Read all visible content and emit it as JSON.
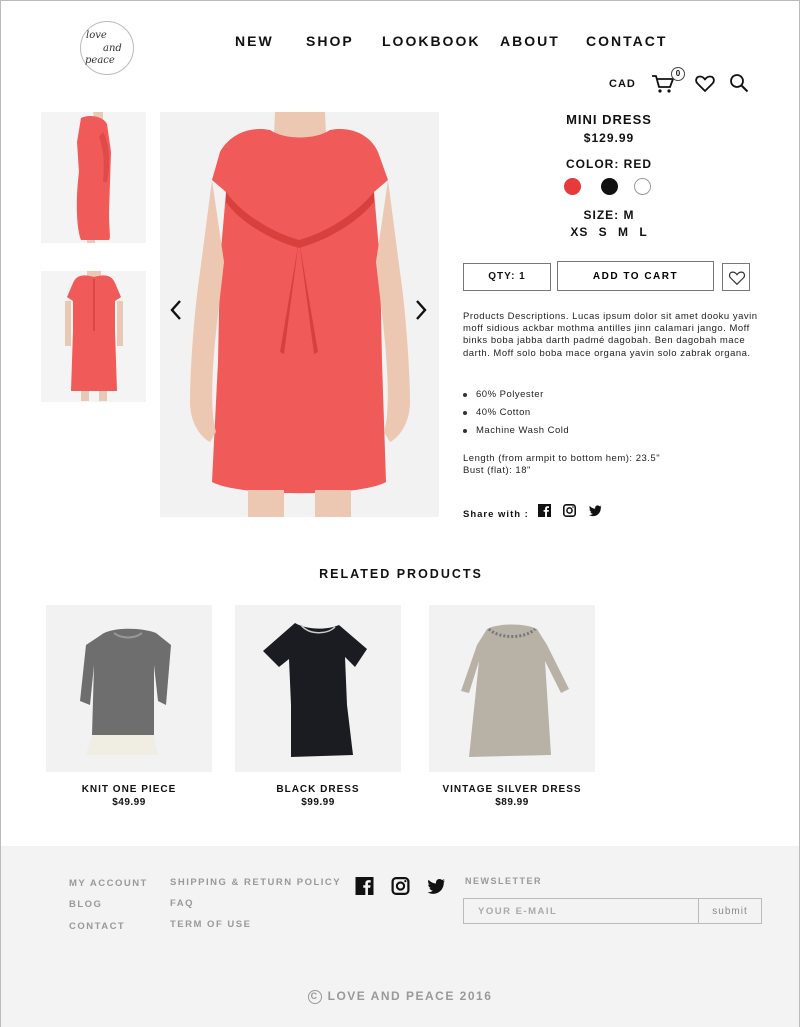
{
  "brand": {
    "logo_line1": "love",
    "logo_line2": "and",
    "logo_line3": "peace"
  },
  "nav": {
    "items": [
      "NEW",
      "SHOP",
      "LOOKBOOK",
      "ABOUT",
      "CONTACT"
    ]
  },
  "utility": {
    "currency": "CAD",
    "cart_count": "0",
    "icons": [
      "cart-icon",
      "heart-icon",
      "search-icon"
    ]
  },
  "product": {
    "name": "MINI DRESS",
    "price": "$129.99",
    "color_label": "COLOR: RED",
    "colors": [
      {
        "name": "red",
        "hex": "#e83a3a"
      },
      {
        "name": "black",
        "hex": "#111111"
      },
      {
        "name": "white",
        "hex": "#ffffff"
      }
    ],
    "size_label": "SIZE: M",
    "sizes": "XS S M L",
    "qty_label": "QTY:  1",
    "add_to_cart": "ADD TO CART",
    "description": "Products Descriptions. Lucas ipsum dolor sit amet dooku yavin moff sidious ackbar mothma antilles jinn calamari jango. Moff binks boba jabba darth padmé dagobah. Ben dagobah mace darth. Moff solo boba mace organa yavin solo zabrak organa.",
    "features": [
      "60% Polyester",
      "40% Cotton",
      "Machine Wash Cold"
    ],
    "measure_length": "Length (from armpit to bottom hem): 23.5\"",
    "measure_bust": "Bust (flat): 18\"",
    "share_label": "Share with :",
    "dress_color": "#f05a58"
  },
  "related": {
    "title": "RELATED PRODUCTS",
    "items": [
      {
        "name": "KNIT ONE PIECE",
        "price": "$49.99"
      },
      {
        "name": "BLACK DRESS",
        "price": "$99.99"
      },
      {
        "name": "VINTAGE SILVER DRESS",
        "price": "$89.99"
      }
    ]
  },
  "footer": {
    "links_col1": [
      "MY ACCOUNT",
      "BLOG",
      "CONTACT"
    ],
    "links_col2": [
      "SHIPPING & RETURN POLICY",
      "FAQ",
      "TERM OF USE"
    ],
    "newsletter_label": "NEWSLETTER",
    "email_placeholder": "YOUR E-MAIL",
    "submit_label": "submit",
    "copyright": "LOVE AND PEACE 2016"
  }
}
